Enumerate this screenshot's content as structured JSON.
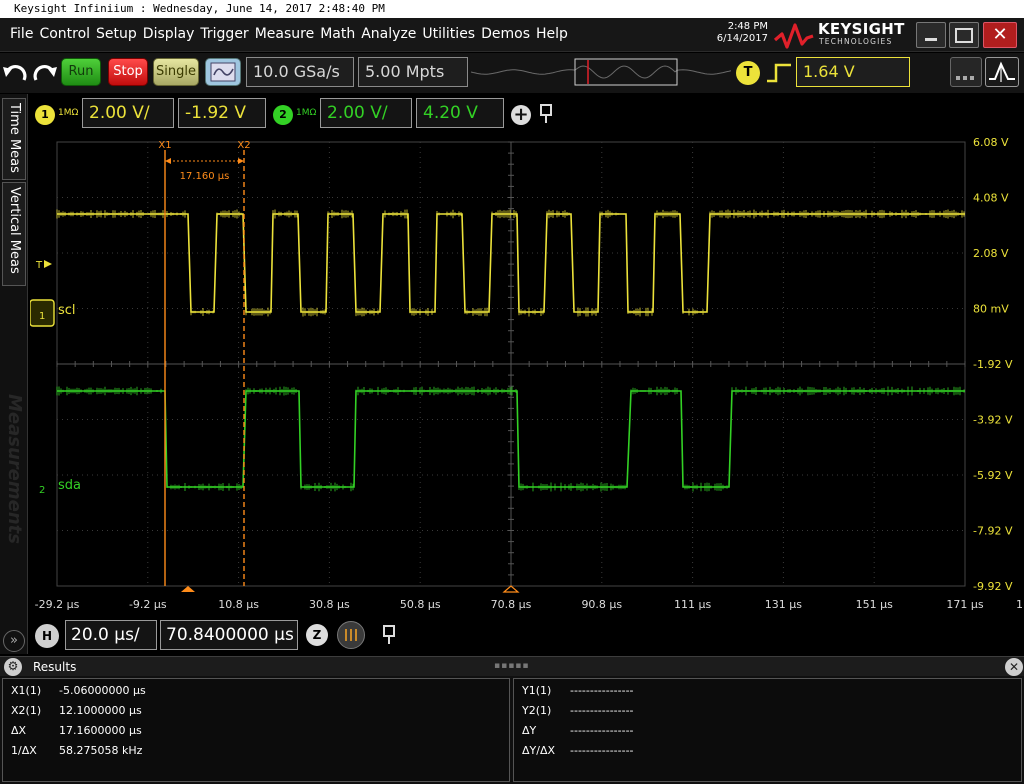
{
  "title": "Keysight Infiniium : Wednesday, June 14, 2017 2:48:40 PM",
  "menu": [
    "File",
    "Control",
    "Setup",
    "Display",
    "Trigger",
    "Measure",
    "Math",
    "Analyze",
    "Utilities",
    "Demos",
    "Help"
  ],
  "datetime": {
    "time": "2:48 PM",
    "date": "6/14/2017"
  },
  "brand": {
    "name": "KEYSIGHT",
    "sub": "TECHNOLOGIES",
    "color": "#e0202a"
  },
  "window": {
    "close_glyph": "✕"
  },
  "toolbar": {
    "run": "Run",
    "stop": "Stop",
    "single": "Single",
    "sample_rate": "10.0 GSa/s",
    "memory_depth": "5.00 Mpts",
    "trigger_badge": "T",
    "trigger_level": "1.64 V"
  },
  "tabs": {
    "time": "Time Meas",
    "vertical": "Vertical Meas",
    "watermark": "Measurements",
    "collapse": "»"
  },
  "channels": [
    {
      "number": "1",
      "impedance": "1MΩ",
      "scale": "2.00 V/",
      "offset": "-1.92 V",
      "color": "#ece23a"
    },
    {
      "number": "2",
      "impedance": "1MΩ",
      "scale": "2.00 V/",
      "offset": "4.20 V",
      "color": "#33d125"
    }
  ],
  "add_channel": "+",
  "plot": {
    "y_labels": [
      "6.08 V",
      "4.08 V",
      "2.08 V",
      "80 mV",
      "-1.92 V",
      "-3.92 V",
      "-5.92 V",
      "-7.92 V",
      "-9.92 V"
    ],
    "x_labels": [
      "-29.2 µs",
      "-9.2 µs",
      "10.8 µs",
      "30.8 µs",
      "50.8 µs",
      "70.8 µs",
      "90.8 µs",
      "111 µs",
      "131 µs",
      "151 µs",
      "171 µs"
    ],
    "x_overflow": "1",
    "cursor_labels": {
      "x1": "X1",
      "x2": "X2",
      "delta": "17.160 µs"
    },
    "trigger_marker": "T",
    "ch1_label": "scl",
    "ch2_label": "sda",
    "ch1_ground": "1",
    "ch2_ground": "2",
    "cursor_color": "#ff8c1a"
  },
  "horizontal": {
    "badge": "H",
    "scale": "20.0 µs/",
    "position": "70.8400000 µs",
    "zoom": "Z"
  },
  "results": {
    "title": "Results",
    "grip": "▪▪▪▪▪",
    "rows_left": [
      {
        "label": "X1(1)",
        "value": "-5.06000000 µs"
      },
      {
        "label": "X2(1)",
        "value": "12.1000000 µs"
      },
      {
        "label": "ΔX",
        "value": "17.1600000 µs"
      },
      {
        "label": "1/ΔX",
        "value": "58.275058 kHz"
      }
    ],
    "rows_right": [
      {
        "label": "Y1(1)",
        "value": "----------------"
      },
      {
        "label": "Y2(1)",
        "value": "----------------"
      },
      {
        "label": "ΔY",
        "value": "----------------"
      },
      {
        "label": "ΔY/ΔX",
        "value": "----------------"
      }
    ]
  }
}
